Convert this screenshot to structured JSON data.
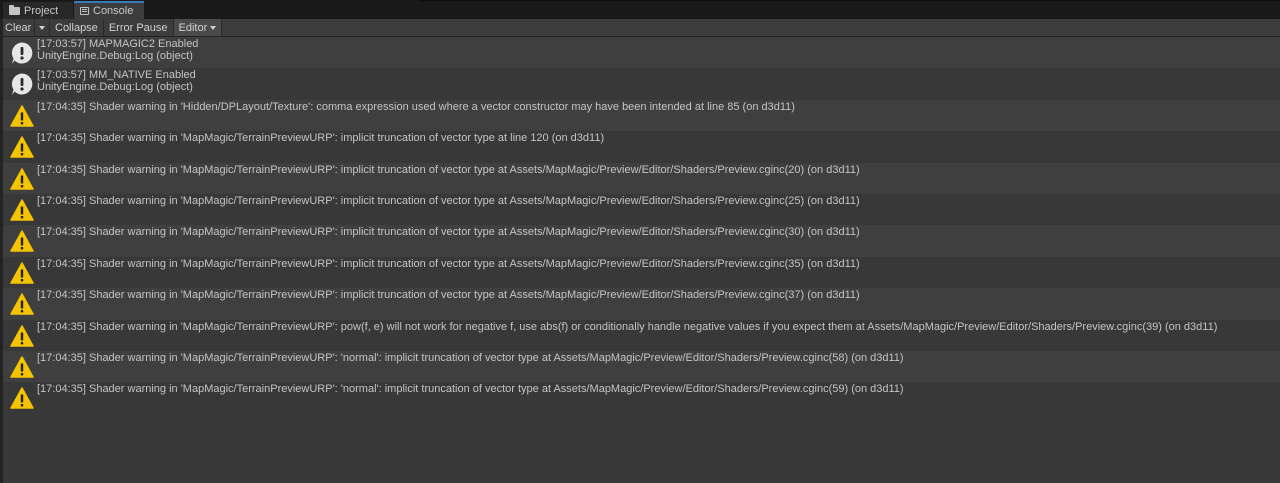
{
  "tabs": [
    {
      "label": "Project",
      "icon": "folder-icon"
    },
    {
      "label": "Console",
      "icon": "console-icon"
    }
  ],
  "toolbar": {
    "clear_label": "Clear",
    "collapse_label": "Collapse",
    "error_pause_label": "Error Pause",
    "editor_label": "Editor"
  },
  "colors": {
    "background": "#383838",
    "alt_row": "#3f3f3f",
    "warning": "#f5c400",
    "info": "#e6e6e6"
  },
  "log_entries": [
    {
      "type": "info",
      "line1": "[17:03:57] MAPMAGIC2 Enabled",
      "line2": "UnityEngine.Debug:Log (object)"
    },
    {
      "type": "info",
      "line1": "[17:03:57] MM_NATIVE Enabled",
      "line2": "UnityEngine.Debug:Log (object)"
    },
    {
      "type": "warning",
      "line1": "[17:04:35] Shader warning in 'Hidden/DPLayout/Texture': comma expression used where a vector constructor may have been intended at line 85 (on d3d11)"
    },
    {
      "type": "warning",
      "line1": "[17:04:35] Shader warning in 'MapMagic/TerrainPreviewURP': implicit truncation of vector type at line 120 (on d3d11)"
    },
    {
      "type": "warning",
      "line1": "[17:04:35] Shader warning in 'MapMagic/TerrainPreviewURP': implicit truncation of vector type at Assets/MapMagic/Preview/Editor/Shaders/Preview.cginc(20) (on d3d11)"
    },
    {
      "type": "warning",
      "line1": "[17:04:35] Shader warning in 'MapMagic/TerrainPreviewURP': implicit truncation of vector type at Assets/MapMagic/Preview/Editor/Shaders/Preview.cginc(25) (on d3d11)"
    },
    {
      "type": "warning",
      "line1": "[17:04:35] Shader warning in 'MapMagic/TerrainPreviewURP': implicit truncation of vector type at Assets/MapMagic/Preview/Editor/Shaders/Preview.cginc(30) (on d3d11)"
    },
    {
      "type": "warning",
      "line1": "[17:04:35] Shader warning in 'MapMagic/TerrainPreviewURP': implicit truncation of vector type at Assets/MapMagic/Preview/Editor/Shaders/Preview.cginc(35) (on d3d11)"
    },
    {
      "type": "warning",
      "line1": "[17:04:35] Shader warning in 'MapMagic/TerrainPreviewURP': implicit truncation of vector type at Assets/MapMagic/Preview/Editor/Shaders/Preview.cginc(37) (on d3d11)"
    },
    {
      "type": "warning",
      "line1": "[17:04:35] Shader warning in 'MapMagic/TerrainPreviewURP': pow(f, e) will not work for negative f, use abs(f) or conditionally handle negative values if you expect them at Assets/MapMagic/Preview/Editor/Shaders/Preview.cginc(39) (on d3d11)"
    },
    {
      "type": "warning",
      "line1": "[17:04:35] Shader warning in 'MapMagic/TerrainPreviewURP': 'normal': implicit truncation of vector type at Assets/MapMagic/Preview/Editor/Shaders/Preview.cginc(58) (on d3d11)"
    },
    {
      "type": "warning",
      "line1": "[17:04:35] Shader warning in 'MapMagic/TerrainPreviewURP': 'normal': implicit truncation of vector type at Assets/MapMagic/Preview/Editor/Shaders/Preview.cginc(59) (on d3d11)"
    }
  ]
}
